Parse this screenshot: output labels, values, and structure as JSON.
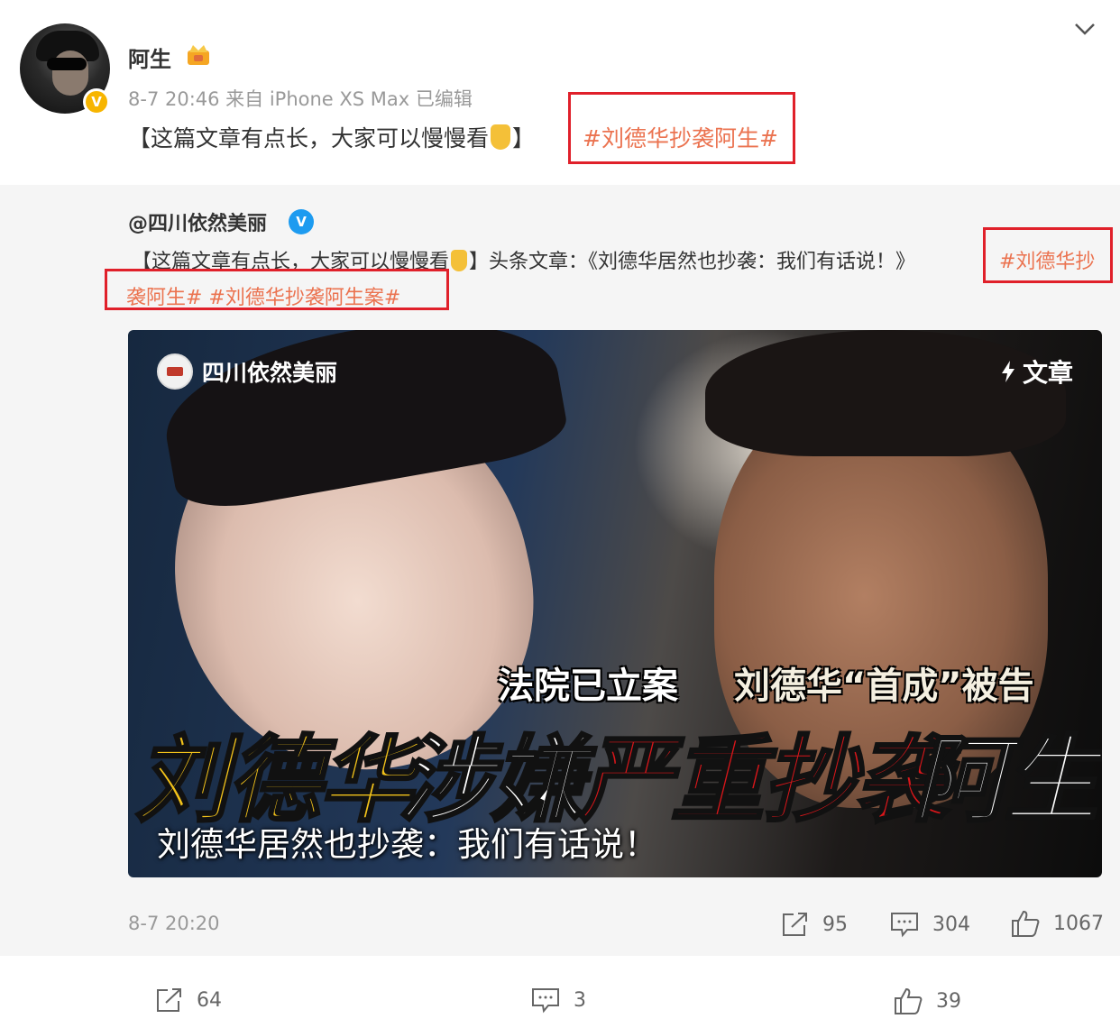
{
  "author": {
    "name": "阿生",
    "verified_badge": "V",
    "meta": "8-7 20:46  来自 iPhone XS Max 已编辑"
  },
  "post": {
    "text": "【这篇文章有点长，大家可以慢慢看",
    "text_close": "】",
    "hashtag": "#刘德华抄袭阿生#"
  },
  "repost": {
    "author": "@四川依然美丽",
    "verified_badge": "V",
    "text_a": "【这篇文章有点长，大家可以慢慢看",
    "text_b": "】头条文章：《刘德华居然也抄袭：我们有话说！》",
    "hashtag_a": "#刘德华抄",
    "hashtag_b": "袭阿生# #刘德华抄袭阿生案#",
    "time": "8-7 20:20",
    "shares": "95",
    "comments": "304",
    "likes": "1067"
  },
  "card": {
    "source": "四川依然美丽",
    "type": "文章",
    "caption_1": "法院已立案",
    "caption_2": "刘德华“首成”被告",
    "big_1": "刘德华",
    "big_2": "涉嫌",
    "big_3": "严重抄袭",
    "big_4": "阿生",
    "title": "刘德华居然也抄袭：我们有话说！"
  },
  "bottom": {
    "shares": "64",
    "comments": "3",
    "likes": "39"
  },
  "colors": {
    "hashtag": "#eb7350",
    "highlight_box": "#e0202a",
    "verified_gold": "#f7b500",
    "verified_blue": "#1d9bf0"
  },
  "icons": [
    "chevron-down-icon",
    "crown-icon",
    "share-icon",
    "comment-icon",
    "like-icon",
    "lightning-icon",
    "pointing-hand-emoji"
  ]
}
